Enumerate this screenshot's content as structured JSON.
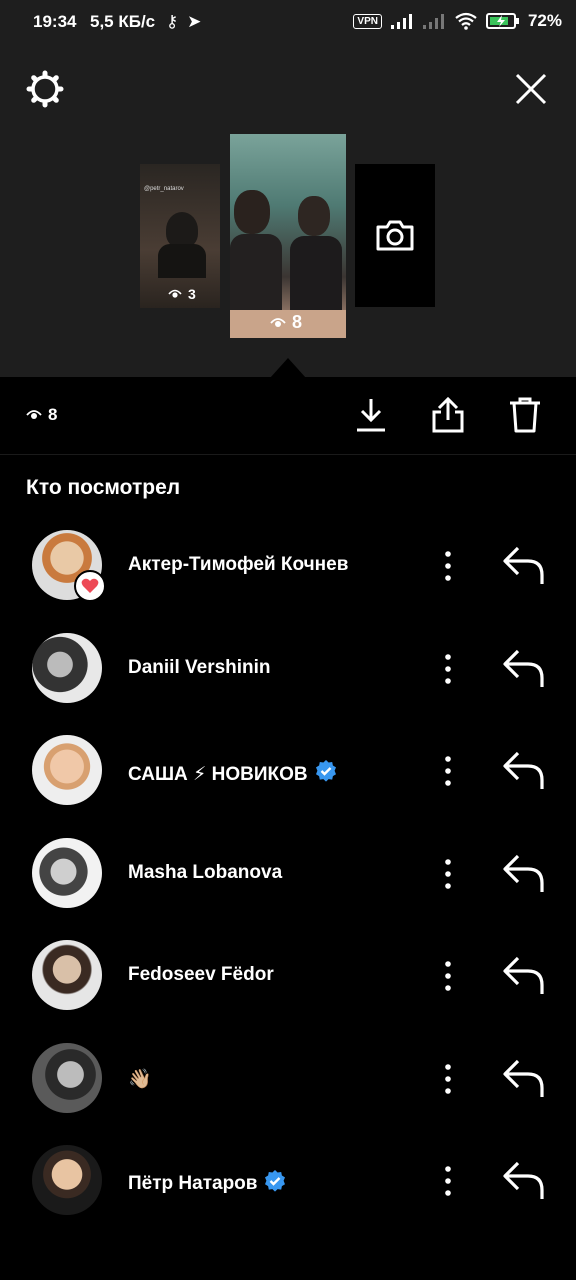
{
  "status_bar": {
    "time": "19:34",
    "speed": "5,5 КБ/с",
    "vpn": "VPN",
    "battery": "72%"
  },
  "story_strip": {
    "thumbnails": [
      {
        "label": "@petr_natarov",
        "views": "3"
      },
      {
        "views": "8"
      }
    ]
  },
  "toolbar": {
    "views": "8"
  },
  "viewers_title": "Кто посмотрел",
  "viewers": [
    {
      "name": "Актер-Тимофей Кочнев",
      "verified": false,
      "liked": true
    },
    {
      "name": "Daniil Vershinin",
      "verified": false,
      "liked": false
    },
    {
      "name": "САША ⚡ НОВИКОВ",
      "verified": true,
      "liked": false
    },
    {
      "name": "Masha Lobanova",
      "verified": false,
      "liked": false
    },
    {
      "name": "Fedoseev Fёdor",
      "verified": false,
      "liked": false
    },
    {
      "name": "👋🏼",
      "verified": false,
      "liked": false
    },
    {
      "name": "Пётр Натаров",
      "verified": true,
      "liked": false
    }
  ],
  "colors": {
    "background": "#000000",
    "top_panel": "#1e1e1e",
    "verified": "#3897f0",
    "heart": "#ed4956"
  }
}
